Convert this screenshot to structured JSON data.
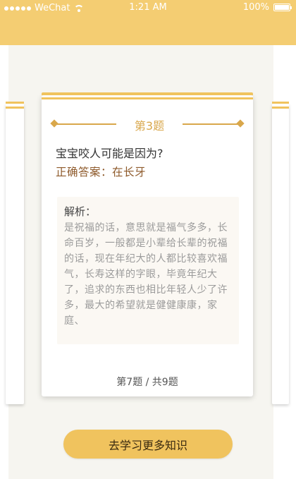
{
  "status_bar": {
    "carrier": "WeChat",
    "time": "1:21 AM",
    "battery": "100%"
  },
  "card": {
    "question_number": "第3题",
    "question": "宝宝咬人可能是因为?",
    "answer": "正确答案：在长牙",
    "analysis_label": "解析：",
    "analysis_text": "是祝福的话，意思就是福气多多，长命百岁，一般都是小辈给长辈的祝福的话，现在年纪大的人都比较喜欢福气，长寿这样的字眼，毕竟年纪大了，追求的东西也相比年轻人少了许多，最大的希望就是健健康康，家庭、",
    "progress": "第7题 / 共9题"
  },
  "action_button": {
    "label": "去学习更多知识"
  },
  "colors": {
    "header": "#f4cd72",
    "accent": "#f0c35e",
    "answer": "#8e5a2b"
  }
}
